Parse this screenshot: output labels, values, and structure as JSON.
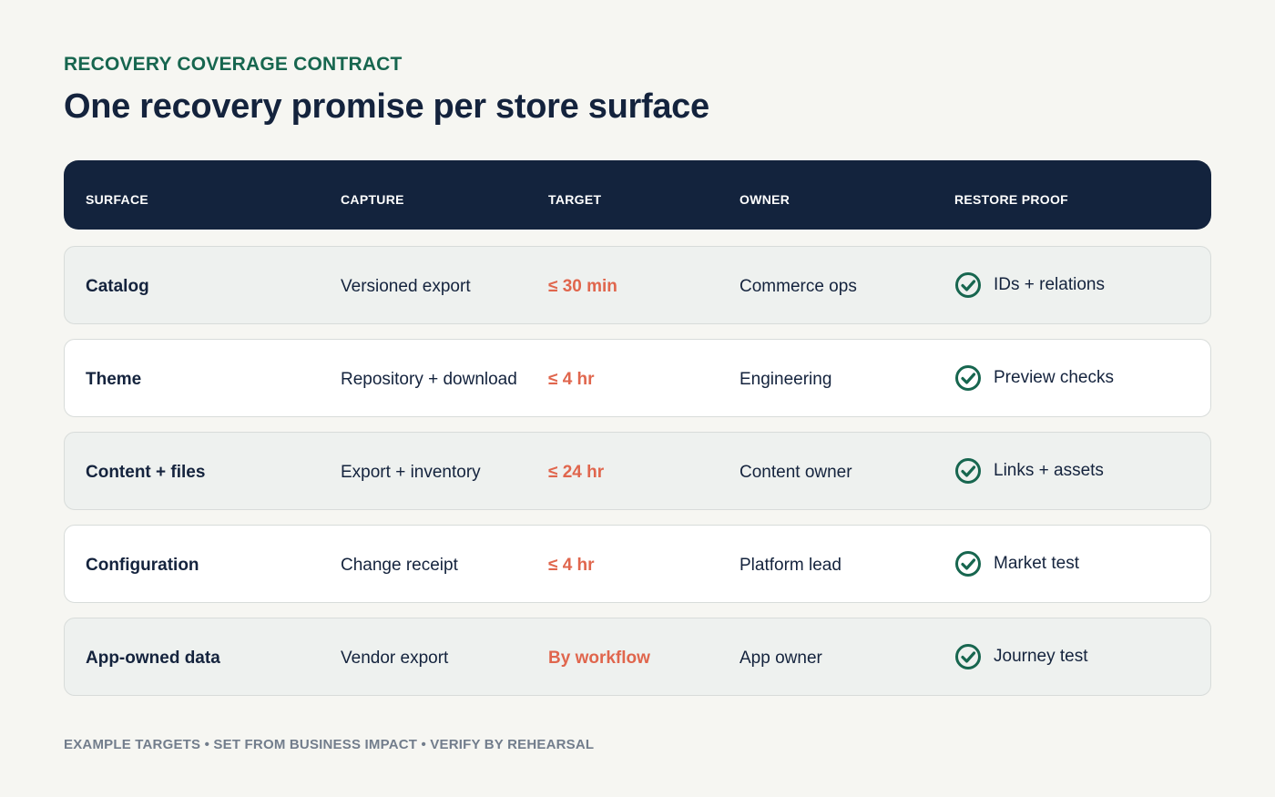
{
  "eyebrow": "RECOVERY COVERAGE CONTRACT",
  "title": "One recovery promise per store surface",
  "table": {
    "headers": {
      "surface": "SURFACE",
      "capture": "CAPTURE",
      "target": "TARGET",
      "owner": "OWNER",
      "proof": "RESTORE PROOF"
    },
    "rows": [
      {
        "surface": "Catalog",
        "capture": "Versioned export",
        "target": "≤ 30 min",
        "owner": "Commerce ops",
        "proof": "IDs + relations"
      },
      {
        "surface": "Theme",
        "capture": "Repository + download",
        "target": "≤ 4 hr",
        "owner": "Engineering",
        "proof": "Preview checks"
      },
      {
        "surface": "Content + files",
        "capture": "Export + inventory",
        "target": "≤ 24 hr",
        "owner": "Content owner",
        "proof": "Links + assets"
      },
      {
        "surface": "Configuration",
        "capture": "Change receipt",
        "target": "≤ 4 hr",
        "owner": "Platform lead",
        "proof": "Market test"
      },
      {
        "surface": "App-owned data",
        "capture": "Vendor export",
        "target": "By workflow",
        "owner": "App owner",
        "proof": "Journey test"
      }
    ]
  },
  "footer": "EXAMPLE TARGETS • SET FROM BUSINESS IMPACT • VERIFY BY REHEARSAL",
  "colors": {
    "accent": "#17664f",
    "header_bg": "#13233d",
    "target": "#e0664d",
    "check": "#17664f"
  },
  "icons": {
    "proof": "check-circle-icon"
  }
}
